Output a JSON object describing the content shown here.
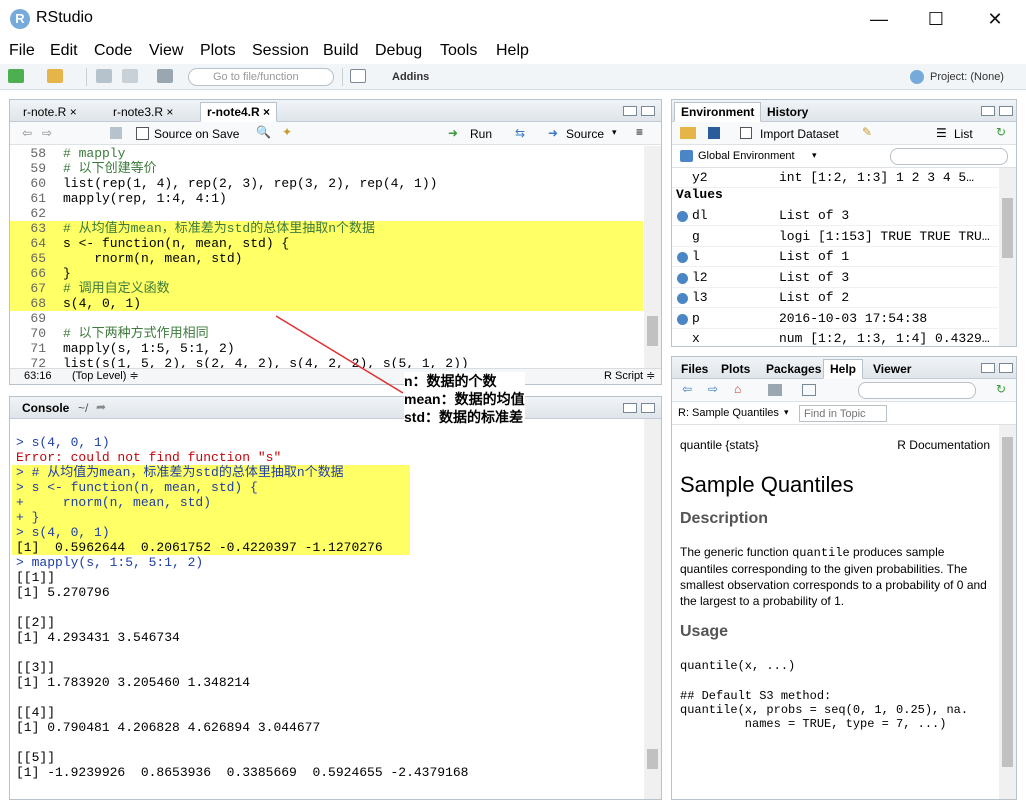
{
  "window": {
    "title": "RStudio",
    "minimize": "—",
    "maximize": "☐",
    "close": "✕"
  },
  "menu": [
    "File",
    "Edit",
    "Code",
    "View",
    "Plots",
    "Session",
    "Build",
    "Debug",
    "Tools",
    "Help"
  ],
  "toolbar": {
    "goto_placeholder": "Go to file/function",
    "addins": "Addins",
    "project": "Project: (None)"
  },
  "editor": {
    "tabs": [
      "r-note.R",
      "r-note3.R",
      "r-note4.R"
    ],
    "source_on_save": "Source on Save",
    "run": "Run",
    "source": "Source",
    "lines": [
      {
        "n": "58",
        "t": "# mapply",
        "cm": true,
        "hl": false
      },
      {
        "n": "59",
        "t": "# 以下创建等价",
        "cm": true,
        "hl": false
      },
      {
        "n": "60",
        "t": "list(rep(1, 4), rep(2, 3), rep(3, 2), rep(4, 1))",
        "cm": false,
        "hl": false
      },
      {
        "n": "61",
        "t": "mapply(rep, 1:4, 4:1)",
        "cm": false,
        "hl": false
      },
      {
        "n": "62",
        "t": "",
        "cm": false,
        "hl": false
      },
      {
        "n": "63",
        "t": "# 从均值为mean，标准差为std的总体里抽取n个数据",
        "cm": true,
        "hl": true
      },
      {
        "n": "64",
        "t": "s <- function(n, mean, std) {",
        "cm": false,
        "hl": true
      },
      {
        "n": "65",
        "t": "    rnorm(n, mean, std)",
        "cm": false,
        "hl": true
      },
      {
        "n": "66",
        "t": "}",
        "cm": false,
        "hl": true
      },
      {
        "n": "67",
        "t": "# 调用自定义函数",
        "cm": true,
        "hl": true
      },
      {
        "n": "68",
        "t": "s(4, 0, 1)",
        "cm": false,
        "hl": true
      },
      {
        "n": "69",
        "t": "",
        "cm": false,
        "hl": false
      },
      {
        "n": "70",
        "t": "# 以下两种方式作用相同",
        "cm": true,
        "hl": false
      },
      {
        "n": "71",
        "t": "mapply(s, 1:5, 5:1, 2)",
        "cm": false,
        "hl": false
      },
      {
        "n": "72",
        "t": "list(s(1, 5, 2), s(2, 4, 2), s(4, 2, 2), s(5, 1, 2))",
        "cm": false,
        "hl": false
      }
    ],
    "status_pos": "63:16",
    "status_level": "(Top Level) ≑",
    "status_type": "R Script ≑"
  },
  "annotation": {
    "l1": "n：数据的个数",
    "l2": "mean：数据的均值",
    "l3": "std：数据的标准差"
  },
  "console": {
    "title": "Console",
    "path": "~/",
    "lines": [
      {
        "t": "> s(4, 0, 1)",
        "c": "blue",
        "hl": false
      },
      {
        "t": "Error: could not find function \"s\"",
        "c": "red",
        "hl": false
      },
      {
        "t": "> # 从均值为mean，标准差为std的总体里抽取n个数据",
        "c": "blue",
        "hl": true
      },
      {
        "t": "> s <- function(n, mean, std) {",
        "c": "blue",
        "hl": true
      },
      {
        "t": "+     rnorm(n, mean, std)",
        "c": "blue",
        "hl": true
      },
      {
        "t": "+ }",
        "c": "blue",
        "hl": true
      },
      {
        "t": "> s(4, 0, 1)",
        "c": "blue",
        "hl": true
      },
      {
        "t": "[1]  0.5962644  0.2061752 -0.4220397 -1.1270276",
        "c": "",
        "hl": true
      },
      {
        "t": "> mapply(s, 1:5, 5:1, 2)",
        "c": "blue",
        "hl": false
      },
      {
        "t": "[[1]]",
        "c": "",
        "hl": false
      },
      {
        "t": "[1] 5.270796",
        "c": "",
        "hl": false
      },
      {
        "t": "",
        "c": "",
        "hl": false
      },
      {
        "t": "[[2]]",
        "c": "",
        "hl": false
      },
      {
        "t": "[1] 4.293431 3.546734",
        "c": "",
        "hl": false
      },
      {
        "t": "",
        "c": "",
        "hl": false
      },
      {
        "t": "[[3]]",
        "c": "",
        "hl": false
      },
      {
        "t": "[1] 1.783920 3.205460 1.348214",
        "c": "",
        "hl": false
      },
      {
        "t": "",
        "c": "",
        "hl": false
      },
      {
        "t": "[[4]]",
        "c": "",
        "hl": false
      },
      {
        "t": "[1] 0.790481 4.206828 4.626894 3.044677",
        "c": "",
        "hl": false
      },
      {
        "t": "",
        "c": "",
        "hl": false
      },
      {
        "t": "[[5]]",
        "c": "",
        "hl": false
      },
      {
        "t": "[1] -1.9239926  0.8653936  0.3385669  0.5924655 -2.4379168",
        "c": "",
        "hl": false
      }
    ]
  },
  "environment": {
    "tabs": [
      "Environment",
      "History"
    ],
    "import_dataset": "Import Dataset",
    "list_view": "List",
    "scope": "Global Environment",
    "top_row": {
      "name": "y2",
      "value": "int [1:2, 1:3] 1 2 3 4 5…"
    },
    "section": "Values",
    "rows": [
      {
        "name": "dl",
        "value": "List of 3",
        "exp": true
      },
      {
        "name": "g",
        "value": "logi [1:153] TRUE TRUE TRU…",
        "exp": false
      },
      {
        "name": "l",
        "value": "List of 1",
        "exp": true
      },
      {
        "name": "l2",
        "value": "List of 3",
        "exp": true
      },
      {
        "name": "l3",
        "value": "List of 2",
        "exp": true
      },
      {
        "name": "p",
        "value": "2016-10-03 17:54:38",
        "exp": true
      },
      {
        "name": "x",
        "value": "num [1:2, 1:3, 1:4] 0.4329…",
        "exp": false
      }
    ]
  },
  "help": {
    "tabs": [
      "Files",
      "Plots",
      "Packages",
      "Help",
      "Viewer"
    ],
    "topic_select": "R: Sample Quantiles",
    "find_placeholder": "Find in Topic",
    "pkg": "quantile {stats}",
    "doc_label": "R Documentation",
    "title": "Sample Quantiles",
    "description_h": "Description",
    "description_pre": "The generic function ",
    "description_code": "quantile",
    "description_post": " produces sample quantiles corresponding to the given probabilities. The smallest observation corresponds to a probability of 0 and the largest to a probability of 1.",
    "usage_h": "Usage",
    "usage_1": "quantile(x, ...)",
    "usage_2": "## Default S3 method:",
    "usage_3": "quantile(x, probs = seq(0, 1, 0.25), na.",
    "usage_4": "         names = TRUE, type = 7, ...)"
  },
  "colors": {
    "highlight": "#ffff66",
    "comment": "#3c7a3c",
    "console_input": "#1f3ea6",
    "error": "#c5060b",
    "annotation_line": "#e03030"
  }
}
